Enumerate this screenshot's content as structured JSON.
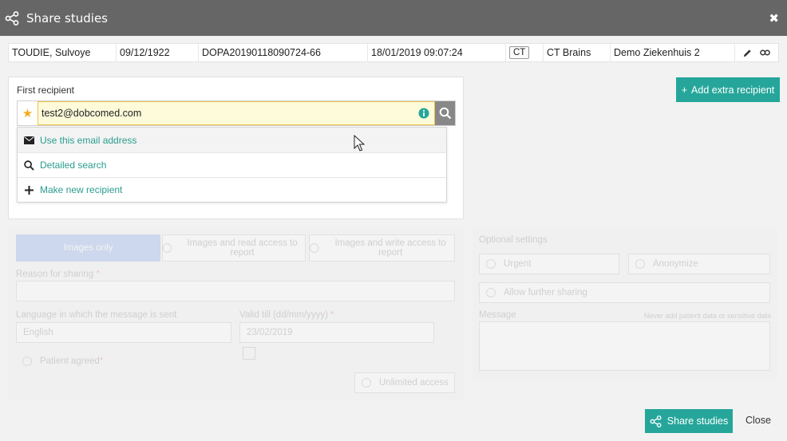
{
  "dialog": {
    "title": "Share studies",
    "close_glyph": "✖"
  },
  "study": {
    "patient_name": "TOUDIE, Sulvoye",
    "birth_date": "09/12/1922",
    "accession": "DOPA20190118090724-66",
    "study_datetime": "18/01/2019 09:07:24",
    "modality": "CT",
    "description": "CT Brains",
    "institution": "Demo Ziekenhuis 2"
  },
  "recipient": {
    "label": "First recipient",
    "input_value": "test2@dobcomed.com",
    "options": [
      {
        "label": "Use this email address",
        "icon": "envelope-icon"
      },
      {
        "label": "Detailed search",
        "icon": "search-icon"
      },
      {
        "label": "Make new recipient",
        "icon": "plus-icon"
      }
    ]
  },
  "add_recipient_label": "Add extra recipient",
  "access": {
    "images_only": "Images only",
    "read_access": "Images and read access to report",
    "write_access": "Images and write access to report"
  },
  "form": {
    "reason_label": "Reason for sharing",
    "required_marker": "*",
    "language_label": "Language in which the message is sent",
    "language_value": "English",
    "valid_till_label": "Valid till (dd/mm/yyyy)",
    "valid_till_value": "23/02/2019",
    "patient_agreed": "Patient agreed",
    "unlimited_access": "Unlimited access"
  },
  "optional": {
    "title": "Optional settings",
    "urgent": "Urgent",
    "anonymize": "Anonymize",
    "allow_sharing": "Allow further sharing",
    "message_label": "Message",
    "message_hint": "Never add patient data or sensitive data"
  },
  "footer": {
    "share_label": "Share studies",
    "close_label": "Close"
  },
  "colors": {
    "accent": "#26a69a",
    "titlebar": "#666666",
    "selected_access": "#2a62d8"
  }
}
